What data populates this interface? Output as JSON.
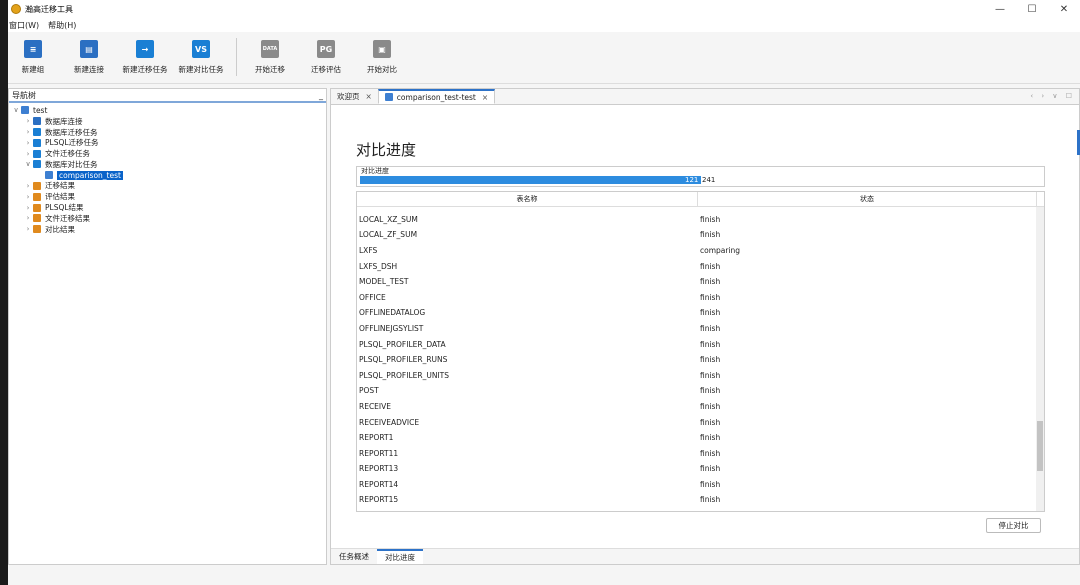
{
  "app": {
    "title": "瀚高迁移工具",
    "window_controls": [
      "—",
      "☐",
      "✕"
    ]
  },
  "menu": [
    {
      "label": "窗口(W)"
    },
    {
      "label": "帮助(H)"
    }
  ],
  "toolbar": [
    {
      "label": "新建组",
      "icon": "new-group-icon",
      "color": "#2b6fc2",
      "glyph": "≡"
    },
    {
      "label": "新建连接",
      "icon": "new-connection-icon",
      "color": "#2b6fc2",
      "glyph": "▤"
    },
    {
      "label": "新建迁移任务",
      "icon": "new-migration-task-icon",
      "color": "#1a7fd4",
      "glyph": "→"
    },
    {
      "label": "新建对比任务",
      "icon": "new-compare-task-icon",
      "color": "#1a7fd4",
      "glyph": "VS"
    },
    {
      "label": "开始迁移",
      "icon": "start-migration-icon",
      "color": "#8a8a8a",
      "glyph": "DATA"
    },
    {
      "label": "迁移评估",
      "icon": "migration-evaluation-icon",
      "color": "#8a8a8a",
      "glyph": "PG"
    },
    {
      "label": "开始对比",
      "icon": "start-compare-icon",
      "color": "#8a8a8a",
      "glyph": "▣"
    }
  ],
  "nav": {
    "title": "导航树",
    "minimize": "_",
    "items": [
      {
        "label": "test",
        "chevron": "∨",
        "level": 0,
        "icon_color": "#3d7fd1"
      },
      {
        "label": "数据库连接",
        "chevron": "›",
        "level": 1,
        "icon_color": "#2b6fc2"
      },
      {
        "label": "数据库迁移任务",
        "chevron": "›",
        "level": 1,
        "icon_color": "#1a7fd4"
      },
      {
        "label": "PLSQL迁移任务",
        "chevron": "›",
        "level": 1,
        "icon_color": "#1a7fd4"
      },
      {
        "label": "文件迁移任务",
        "chevron": "›",
        "level": 1,
        "icon_color": "#1a7fd4"
      },
      {
        "label": "数据库对比任务",
        "chevron": "∨",
        "level": 1,
        "icon_color": "#1a7fd4"
      },
      {
        "label": "comparison_test",
        "chevron": "",
        "level": 2,
        "icon_color": "#3d7fd1",
        "selected": true
      },
      {
        "label": "迁移结果",
        "chevron": "›",
        "level": 1,
        "icon_color": "#e08a1e"
      },
      {
        "label": "评估结果",
        "chevron": "›",
        "level": 1,
        "icon_color": "#e08a1e"
      },
      {
        "label": "PLSQL结果",
        "chevron": "›",
        "level": 1,
        "icon_color": "#e08a1e"
      },
      {
        "label": "文件迁移结果",
        "chevron": "›",
        "level": 1,
        "icon_color": "#e08a1e"
      },
      {
        "label": "对比结果",
        "chevron": "›",
        "level": 1,
        "icon_color": "#e08a1e"
      }
    ]
  },
  "tabs": [
    {
      "label": "欢迎页",
      "close": "×",
      "active": false
    },
    {
      "label": "comparison_test-test",
      "close": "×",
      "active": true
    }
  ],
  "tab_controls": "‹ › ∨ ☐",
  "page": {
    "title": "对比进度",
    "progress_label": "对比进度",
    "progress_current": "121",
    "progress_total": "241",
    "progress_fraction": 0.502,
    "columns": [
      "表名称",
      "状态"
    ],
    "rows": [
      {
        "name": "LOCAL_XZ_SUM",
        "status": "finish"
      },
      {
        "name": "LOCAL_ZF_SUM",
        "status": "finish"
      },
      {
        "name": "LXFS",
        "status": "comparing"
      },
      {
        "name": "LXFS_DSH",
        "status": "finish"
      },
      {
        "name": "MODEL_TEST",
        "status": "finish"
      },
      {
        "name": "OFFICE",
        "status": "finish"
      },
      {
        "name": "OFFLINEDATALOG",
        "status": "finish"
      },
      {
        "name": "OFFLINEJGSYLIST",
        "status": "finish"
      },
      {
        "name": "PLSQL_PROFILER_DATA",
        "status": "finish"
      },
      {
        "name": "PLSQL_PROFILER_RUNS",
        "status": "finish"
      },
      {
        "name": "PLSQL_PROFILER_UNITS",
        "status": "finish"
      },
      {
        "name": "POST",
        "status": "finish"
      },
      {
        "name": "RECEIVE",
        "status": "finish"
      },
      {
        "name": "RECEIVEADVICE",
        "status": "finish"
      },
      {
        "name": "REPORT1",
        "status": "finish"
      },
      {
        "name": "REPORT11",
        "status": "finish"
      },
      {
        "name": "REPORT13",
        "status": "finish"
      },
      {
        "name": "REPORT14",
        "status": "finish"
      },
      {
        "name": "REPORT15",
        "status": "finish"
      }
    ],
    "scroll_fraction": 0.84,
    "stop_button": "停止对比"
  },
  "bottom_tabs": [
    {
      "label": "任务概述",
      "active": false
    },
    {
      "label": "对比进度",
      "active": true
    }
  ]
}
